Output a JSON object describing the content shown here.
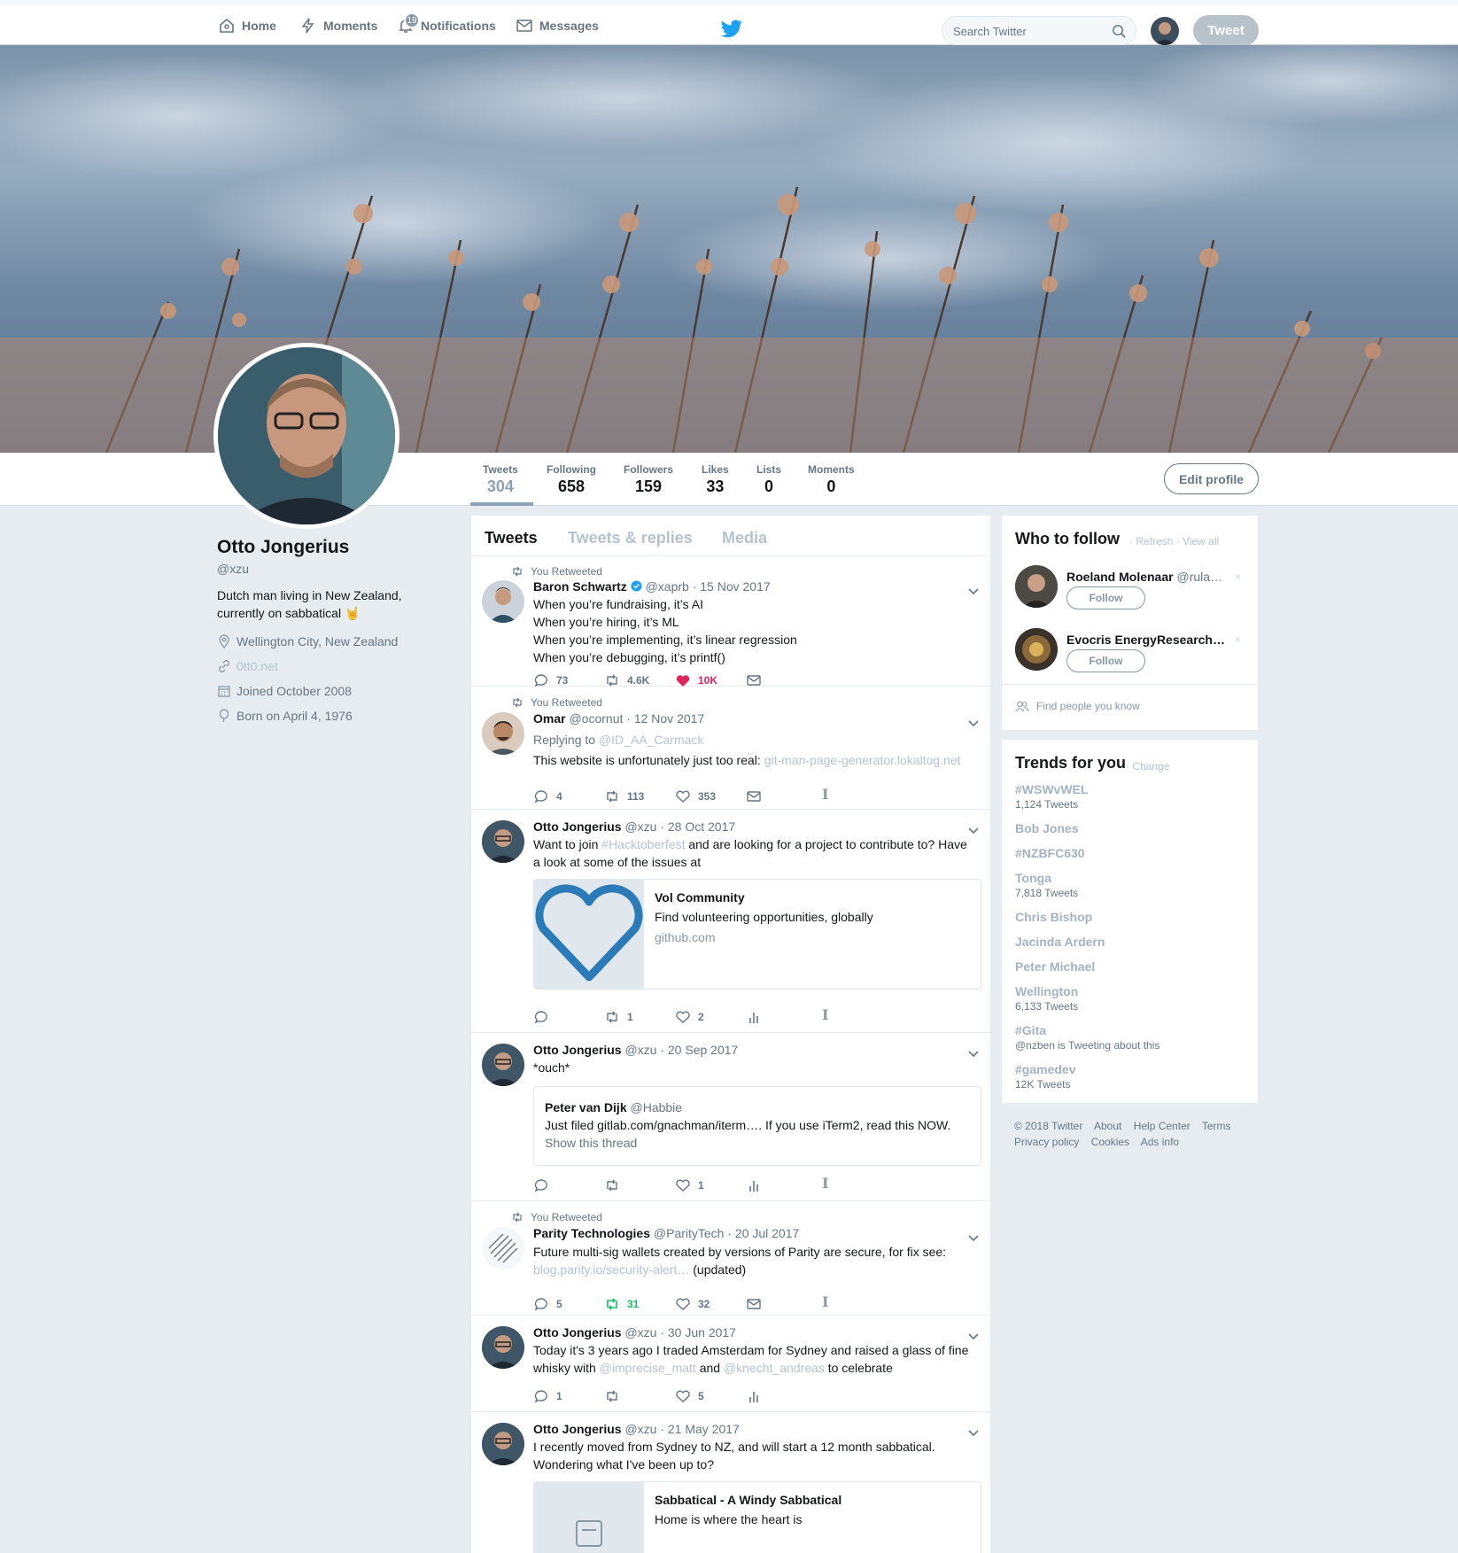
{
  "nav": {
    "home": "Home",
    "moments": "Moments",
    "notifications": "Notifications",
    "notifications_count": "19",
    "messages": "Messages",
    "search_placeholder": "Search Twitter",
    "tweet_button": "Tweet"
  },
  "profile": {
    "name": "Otto Jongerius",
    "handle": "@xzu",
    "bio_line1": "Dutch man living in New Zealand,",
    "bio_line2": "currently on sabbatical 🤘",
    "location": "Wellington City, New Zealand",
    "url": "0tt0.net",
    "joined": "Joined October 2008",
    "born": "Born on April 4, 1976",
    "edit_button": "Edit profile"
  },
  "stats": [
    {
      "label": "Tweets",
      "value": "304"
    },
    {
      "label": "Following",
      "value": "658"
    },
    {
      "label": "Followers",
      "value": "159"
    },
    {
      "label": "Likes",
      "value": "33"
    },
    {
      "label": "Lists",
      "value": "0"
    },
    {
      "label": "Moments",
      "value": "0"
    }
  ],
  "tabs": [
    "Tweets",
    "Tweets & replies",
    "Media"
  ],
  "tweets": [
    {
      "retweeted": "You Retweeted",
      "name": "Baron Schwartz",
      "handle": "@xaprb · 15 Nov 2017",
      "lines": [
        "When you’re fundraising, it’s AI",
        "When you’re hiring, it’s ML",
        "When you’re implementing, it’s linear regression",
        "When you’re debugging, it’s printf()"
      ],
      "replies": "73",
      "retweets": "4.6K",
      "likes": "10K"
    },
    {
      "retweeted": "You Retweeted",
      "name": "Omar",
      "handle": "@ocornut · 12 Nov 2017",
      "replying_prefix": "Replying to",
      "replying_to": "@ID_AA_Carmack",
      "text": "This website is unfortunately just too real:",
      "link": "git-man-page-generator.lokaltog.net",
      "replies": "4",
      "retweets": "113",
      "likes": "353"
    },
    {
      "name": "Otto Jongerius",
      "handle": "@xzu · 28 Oct 2017",
      "text_a": "Want to join",
      "hashtag": "#Hacktoberfest",
      "text_b": " and are looking for a project to contribute to? Have a look at some of the issues at",
      "card_title": "Vol Community",
      "card_desc": "Find volunteering opportunities, globally",
      "card_domain": "github.com",
      "replies": "",
      "retweets": "1",
      "likes": "2"
    },
    {
      "name": "Otto Jongerius",
      "handle": "@xzu · 20 Sep 2017",
      "text": "*ouch*",
      "quote_name": "Peter van Dijk",
      "quote_handle": "@Habbie",
      "quote_text": "Just filed gitlab.com/gnachman/iterm…. If you use iTerm2, read this NOW.",
      "quote_more": "Show this thread",
      "replies": "",
      "retweets": "",
      "likes": "1"
    },
    {
      "retweeted": "You Retweeted",
      "name": "Parity Technologies",
      "handle": "@ParityTech · 20 Jul 2017",
      "text": "Future multi-sig wallets created by versions of Parity are secure, for fix see:",
      "link": "blog.parity.io/security-alert…",
      "link_suffix": " (updated)",
      "replies": "5",
      "retweets": "31",
      "likes": "32"
    },
    {
      "name": "Otto Jongerius",
      "handle": "@xzu · 30 Jun 2017",
      "text_a": "Today it's 3 years ago I traded Amsterdam for Sydney and raised a glass of fine whisky with",
      "mention1": "@imprecise_matt",
      "text_b": " and ",
      "mention2": "@knecht_andreas",
      "text_c": " to celebrate",
      "replies": "1",
      "retweets": "",
      "likes": "5"
    },
    {
      "name": "Otto Jongerius",
      "handle": "@xzu · 21 May 2017",
      "text": "I recently moved from Sydney to NZ, and will start a 12 month sabbatical. Wondering what I've been up to?",
      "card_title": "Sabbatical - A Windy Sabbatical",
      "card_desc": "Home is where the heart is"
    }
  ],
  "who_to_follow": {
    "title": "Who to follow",
    "refresh": "· Refresh",
    "view_all": "· View all",
    "users": [
      {
        "name": "Roeland Molenaar",
        "handle": "@rula…"
      },
      {
        "name": "Evocris EnergyResearch…",
        "handle": ""
      }
    ],
    "follow_label": "Follow",
    "dismiss": "×",
    "find_people": "Find people you know"
  },
  "trends": {
    "title": "Trends for you",
    "change": "· Change",
    "items": [
      {
        "name": "#WSWvWEL",
        "count": "1,124 Tweets"
      },
      {
        "name": "Bob Jones",
        "count": ""
      },
      {
        "name": "#NZBFC630",
        "count": ""
      },
      {
        "name": "Tonga",
        "count": "7,818 Tweets"
      },
      {
        "name": "Chris Bishop",
        "count": ""
      },
      {
        "name": "Jacinda Ardern",
        "count": ""
      },
      {
        "name": "Peter Michael",
        "count": ""
      },
      {
        "name": "Wellington",
        "count": "6,133 Tweets"
      },
      {
        "name": "#Gita",
        "count": "@nzben is Tweeting about this"
      },
      {
        "name": "#gamedev",
        "count": "12K Tweets"
      }
    ]
  },
  "footer": {
    "copyright": "© 2018 Twitter",
    "about": "About",
    "help": "Help Center",
    "terms": "Terms",
    "privacy": "Privacy policy",
    "cookies": "Cookies",
    "ads": "Ads info"
  },
  "colors": {
    "accent": "#1da1f2",
    "like": "#e0245e",
    "retweet": "#17bf63"
  }
}
